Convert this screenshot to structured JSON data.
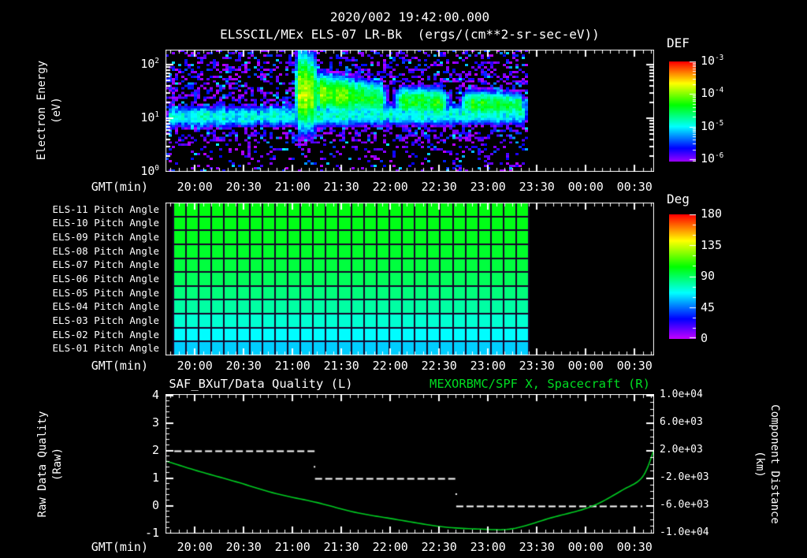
{
  "header": {
    "date_title": "2020/002 19:42:00.000",
    "plot_title": "ELSSCIL/MEx ELS-07 LR-Bk  (ergs/(cm**2-sr-sec-eV))"
  },
  "time_axis": {
    "label": "GMT(min)",
    "start_time": "19:42",
    "span_minutes": 300,
    "ticks": [
      {
        "label": "20:00",
        "frac": 0.06
      },
      {
        "label": "20:30",
        "frac": 0.16
      },
      {
        "label": "21:00",
        "frac": 0.26
      },
      {
        "label": "21:30",
        "frac": 0.36
      },
      {
        "label": "22:00",
        "frac": 0.46
      },
      {
        "label": "22:30",
        "frac": 0.56
      },
      {
        "label": "23:00",
        "frac": 0.66
      },
      {
        "label": "23:30",
        "frac": 0.76
      },
      {
        "label": "00:00",
        "frac": 0.86
      },
      {
        "label": "00:30",
        "frac": 0.96
      }
    ]
  },
  "spectrogram_panel": {
    "ylabel_line1": "Electron Energy",
    "ylabel_line2": "(eV)",
    "ytick_exponents": [
      2,
      1,
      0
    ],
    "colorbar": {
      "title": "DEF",
      "tick_exponents": [
        -3,
        -4,
        -5,
        -6
      ]
    }
  },
  "pitch_panel": {
    "row_labels": [
      "ELS-11 Pitch Angle",
      "ELS-10 Pitch Angle",
      "ELS-09 Pitch Angle",
      "ELS-08 Pitch Angle",
      "ELS-07 Pitch Angle",
      "ELS-06 Pitch Angle",
      "ELS-05 Pitch Angle",
      "ELS-04 Pitch Angle",
      "ELS-03 Pitch Angle",
      "ELS-02 Pitch Angle",
      "ELS-01 Pitch Angle"
    ],
    "colorbar": {
      "title": "Deg",
      "ticks": [
        180,
        135,
        90,
        45,
        0
      ]
    }
  },
  "quality_panel": {
    "title_left": "SAF_BXuT/Data Quality (L)",
    "title_right": "MEXORBMC/SPF X, Spacecraft (R)",
    "ylabel_left_line1": "Raw Data Quality",
    "ylabel_left_line2": "(Raw)",
    "ylabel_right_line1": "Component Distance",
    "ylabel_right_line2": "(km)",
    "yticks_left": [
      4,
      3,
      2,
      1,
      0,
      -1
    ],
    "yticks_right": [
      {
        "label": "1.0e+04",
        "km": 10000
      },
      {
        "label": "6.0e+03",
        "km": 6000
      },
      {
        "label": "2.0e+03",
        "km": 2000
      },
      {
        "label": "-2.0e+03",
        "km": -2000
      },
      {
        "label": "-6.0e+03",
        "km": -6000
      },
      {
        "label": "-1.0e+04",
        "km": -10000
      }
    ]
  },
  "chart_data": [
    {
      "type": "heatmap",
      "name": "electron-energy-spectrogram",
      "title": "ELSSCIL/MEx ELS-07 LR-Bk",
      "flux_unit": "ergs/(cm**2-sr-sec-eV)",
      "xlabel": "GMT(min)",
      "x_start": "19:42",
      "x_end": "00:42",
      "ylabel": "Electron Energy (eV)",
      "y_scale": "log",
      "y_min_ev": 1,
      "y_max_ev": 190,
      "colorbar_label": "DEF",
      "flux_min": 1e-06,
      "flux_max": 0.001,
      "data_end_frac": 0.744,
      "noise": {
        "floor_logF": -6.55,
        "range": 1.05,
        "speckle_prob": 0.05,
        "speckle_logF": -5.3,
        "black_low_logE": 0.55,
        "black_low_prob": 0.5,
        "black_high_logE": 2.05,
        "black_high_prob": 0.3
      },
      "bands": [
        {
          "name": "quiet-cyan-band",
          "t0": 0.0,
          "t1": 0.744,
          "logE0": 1.02,
          "logE1": 1.08,
          "sigma": 0.14,
          "p0": -4.9,
          "p1": -4.9,
          "fade": 0.01
        },
        {
          "name": "injection-burst",
          "t0": 0.262,
          "t1": 0.315,
          "logE0": 1.5,
          "logE1": 1.45,
          "sigma": 0.42,
          "p0": -3.85,
          "p1": -4.1,
          "fade": 0.012
        },
        {
          "name": "burst-high-tail",
          "t0": 0.262,
          "t1": 0.3,
          "logE0": 1.7,
          "logE1": 1.6,
          "sigma": 0.55,
          "p0": -4.5,
          "p1": -4.7,
          "fade": 0.01
        },
        {
          "name": "decay-band",
          "t0": 0.3,
          "t1": 0.46,
          "logE0": 1.48,
          "logE1": 1.33,
          "sigma": 0.22,
          "p0": -4.0,
          "p1": -4.55,
          "fade": 0.02
        },
        {
          "name": "band-2",
          "t0": 0.465,
          "t1": 0.585,
          "logE0": 1.32,
          "logE1": 1.28,
          "sigma": 0.17,
          "p0": -4.3,
          "p1": -4.45,
          "fade": 0.02
        },
        {
          "name": "band-3",
          "t0": 0.6,
          "t1": 0.744,
          "logE0": 1.28,
          "logE1": 1.22,
          "sigma": 0.16,
          "p0": -4.35,
          "p1": -4.5,
          "fade": 0.02
        }
      ]
    },
    {
      "type": "heatmap",
      "name": "pitch-angle-grid",
      "unit": "Deg",
      "value_min": 0,
      "value_max": 180,
      "n_time_cols": 28,
      "data_start_frac": 0.016,
      "data_end_frac": 0.744,
      "rows": [
        {
          "label": "ELS-11 Pitch Angle",
          "pitch_deg": 102
        },
        {
          "label": "ELS-10 Pitch Angle",
          "pitch_deg": 101
        },
        {
          "label": "ELS-09 Pitch Angle",
          "pitch_deg": 100
        },
        {
          "label": "ELS-08 Pitch Angle",
          "pitch_deg": 98
        },
        {
          "label": "ELS-07 Pitch Angle",
          "pitch_deg": 95
        },
        {
          "label": "ELS-06 Pitch Angle",
          "pitch_deg": 91
        },
        {
          "label": "ELS-05 Pitch Angle",
          "pitch_deg": 86
        },
        {
          "label": "ELS-04 Pitch Angle",
          "pitch_deg": 80
        },
        {
          "label": "ELS-03 Pitch Angle",
          "pitch_deg": 73
        },
        {
          "label": "ELS-02 Pitch Angle",
          "pitch_deg": 66
        },
        {
          "label": "ELS-01 Pitch Angle",
          "pitch_deg": 59
        }
      ]
    },
    {
      "type": "line",
      "name": "quality-and-distance",
      "ylim_left": [
        -1,
        4
      ],
      "ylim_right": [
        -10000,
        10000
      ],
      "series": [
        {
          "name": "SAF_BXuT/Data Quality (L)",
          "axis": "left",
          "style": "dashed-white",
          "segments": [
            {
              "value": 2,
              "f0": 0.018,
              "f1": 0.31,
              "t0": "19:47",
              "t1": "21:15"
            },
            {
              "value": 1,
              "f0": 0.306,
              "f1": 0.594,
              "t0": "21:14",
              "t1": "22:40"
            },
            {
              "value": 0,
              "f0": 0.595,
              "f1": 0.976,
              "t0": "22:41",
              "t1": "00:35"
            }
          ],
          "transition_dots": [
            [
              0.305,
              1.42
            ],
            [
              0.595,
              0.43
            ]
          ]
        },
        {
          "name": "MEXORBMC/SPF X, Spacecraft (R)",
          "axis": "right",
          "style": "solid-green",
          "points": [
            [
              0.002,
              500
            ],
            [
              0.065,
              -900
            ],
            [
              0.145,
              -2500
            ],
            [
              0.226,
              -4200
            ],
            [
              0.31,
              -5500
            ],
            [
              0.387,
              -6900
            ],
            [
              0.468,
              -7900
            ],
            [
              0.565,
              -9000
            ],
            [
              0.645,
              -9350
            ],
            [
              0.71,
              -9300
            ],
            [
              0.79,
              -7700
            ],
            [
              0.871,
              -6100
            ],
            [
              0.935,
              -3700
            ],
            [
              0.976,
              -1800
            ],
            [
              1.0,
              2200
            ]
          ]
        }
      ]
    }
  ],
  "colors": {
    "background": "#000000",
    "text": "#ffffff",
    "green_title": "#00dd22",
    "curve_green": "#00cc22",
    "grid_line": "#140228"
  }
}
